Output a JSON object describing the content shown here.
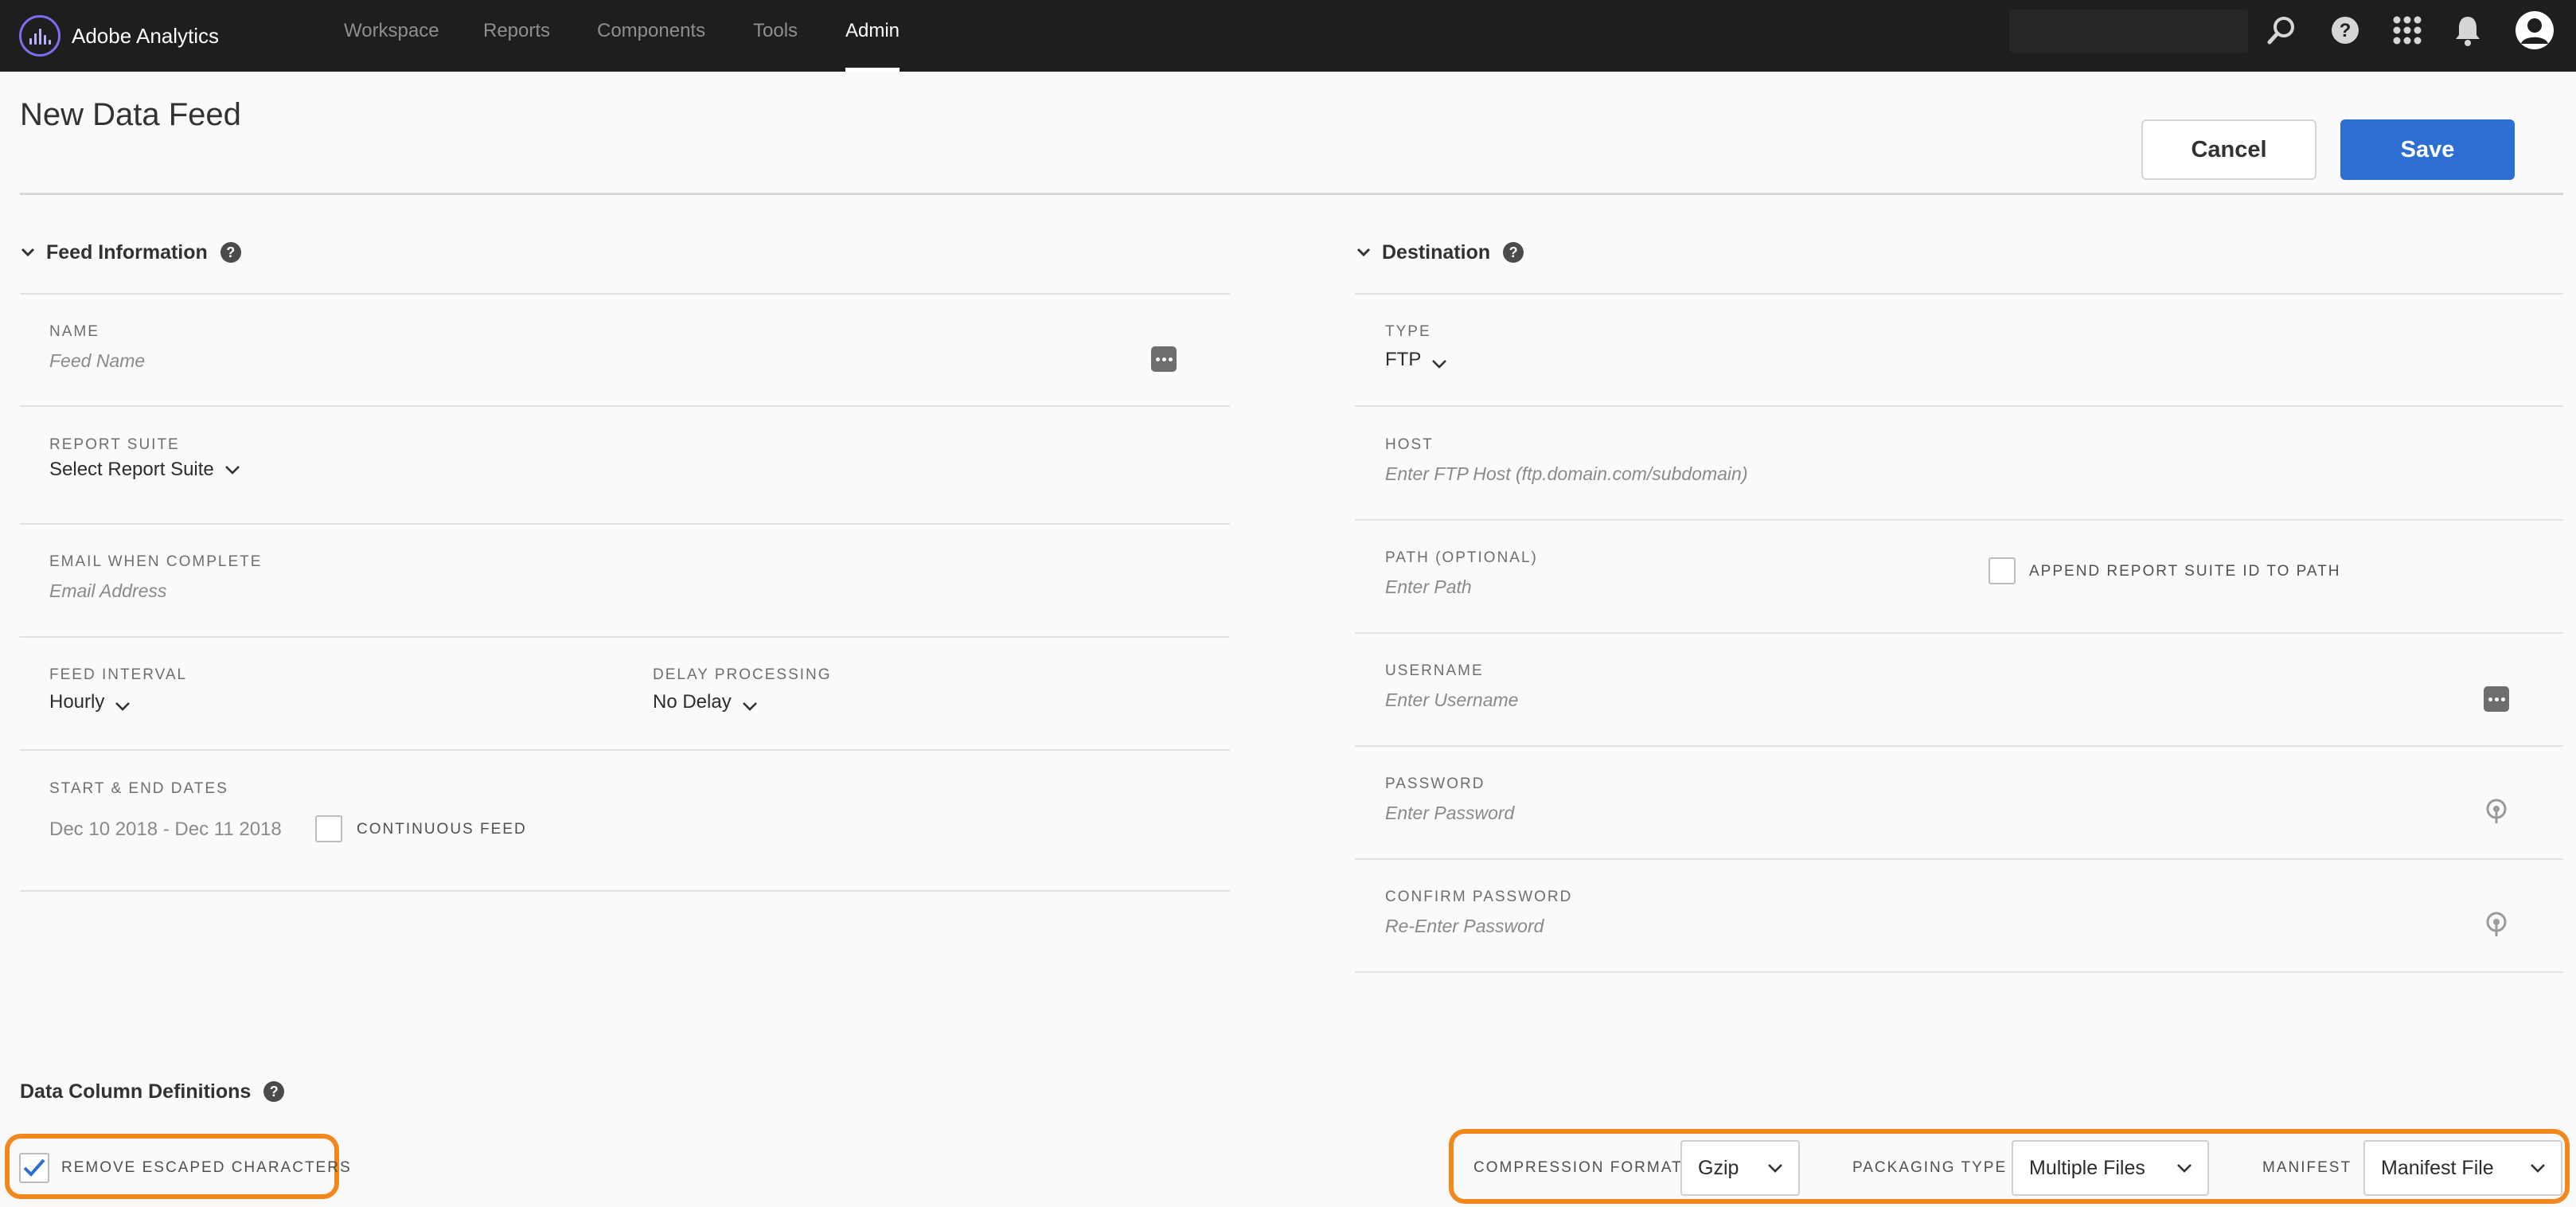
{
  "app": {
    "title": "Adobe Analytics",
    "nav": [
      {
        "label": "Workspace",
        "active": false
      },
      {
        "label": "Reports",
        "active": false
      },
      {
        "label": "Components",
        "active": false
      },
      {
        "label": "Tools",
        "active": false
      },
      {
        "label": "Admin",
        "active": true
      }
    ],
    "icons": [
      "search-icon",
      "help-icon",
      "apps-grid-icon",
      "bell-icon",
      "avatar-icon"
    ]
  },
  "page": {
    "title": "New Data Feed",
    "cancel_label": "Cancel",
    "save_label": "Save"
  },
  "feed_info": {
    "title": "Feed Information",
    "name": {
      "label": "NAME",
      "placeholder": "Feed Name"
    },
    "report_suite": {
      "label": "REPORT SUITE",
      "value": "Select Report Suite"
    },
    "email": {
      "label": "EMAIL WHEN COMPLETE",
      "placeholder": "Email Address"
    },
    "interval": {
      "label": "FEED INTERVAL",
      "value": "Hourly"
    },
    "delay": {
      "label": "DELAY PROCESSING",
      "value": "No Delay"
    },
    "dates": {
      "label": "START & END DATES",
      "value": "Dec 10 2018 - Dec 11 2018"
    },
    "continuous": {
      "label": "CONTINUOUS FEED",
      "checked": false
    }
  },
  "destination": {
    "title": "Destination",
    "type": {
      "label": "TYPE",
      "value": "FTP"
    },
    "host": {
      "label": "HOST",
      "placeholder": "Enter FTP Host (ftp.domain.com/subdomain)"
    },
    "path": {
      "label": "PATH (OPTIONAL)",
      "placeholder": "Enter Path"
    },
    "append": {
      "label": "APPEND REPORT SUITE ID TO PATH",
      "checked": false
    },
    "username": {
      "label": "USERNAME",
      "placeholder": "Enter Username"
    },
    "password": {
      "label": "PASSWORD",
      "placeholder": "Enter Password"
    },
    "confirm": {
      "label": "CONFIRM PASSWORD",
      "placeholder": "Re-Enter Password"
    }
  },
  "columns": {
    "title": "Data Column Definitions",
    "remove_escaped": {
      "label": "REMOVE ESCAPED CHARACTERS",
      "checked": true
    },
    "compression": {
      "label": "COMPRESSION FORMAT",
      "value": "Gzip"
    },
    "packaging": {
      "label": "PACKAGING TYPE",
      "value": "Multiple Files"
    },
    "manifest": {
      "label": "MANIFEST",
      "value": "Manifest File"
    }
  },
  "colors": {
    "topbar": "#1e1e1e",
    "accent": "#2d6ed3",
    "highlight": "#f2871b",
    "check": "#2d6ed3"
  }
}
